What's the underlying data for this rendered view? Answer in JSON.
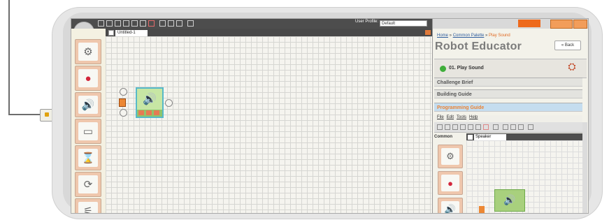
{
  "toolbar": {
    "user_profile_label": "User Profile:",
    "user_profile_value": "Default"
  },
  "editor": {
    "tab_label": "Untitled-1"
  },
  "palette": {
    "items": [
      "gear-icon",
      "record-icon",
      "speaker-icon",
      "display-icon",
      "hourglass-icon",
      "loop-icon",
      "switch-icon"
    ]
  },
  "robot_educator": {
    "breadcrumb_home": "Home",
    "breadcrumb_sep1": " » ",
    "breadcrumb_palette": "Common Palette",
    "breadcrumb_sep2": " » ",
    "breadcrumb_current": "Play Sound",
    "title": "Robot Educator",
    "back_label": "« Back",
    "lesson_label": "01. Play Sound",
    "sections": [
      "Challenge Brief",
      "Building Guide",
      "Programming Guide"
    ]
  },
  "mini_app": {
    "menu": [
      "File",
      "Edit",
      "Tools",
      "Help"
    ],
    "palette_label": "Common",
    "tab_label": "Speaker"
  },
  "colors": {
    "accent": "#ee6a1c",
    "block_green": "#90c46a",
    "palette_bg": "#efc7ad"
  }
}
